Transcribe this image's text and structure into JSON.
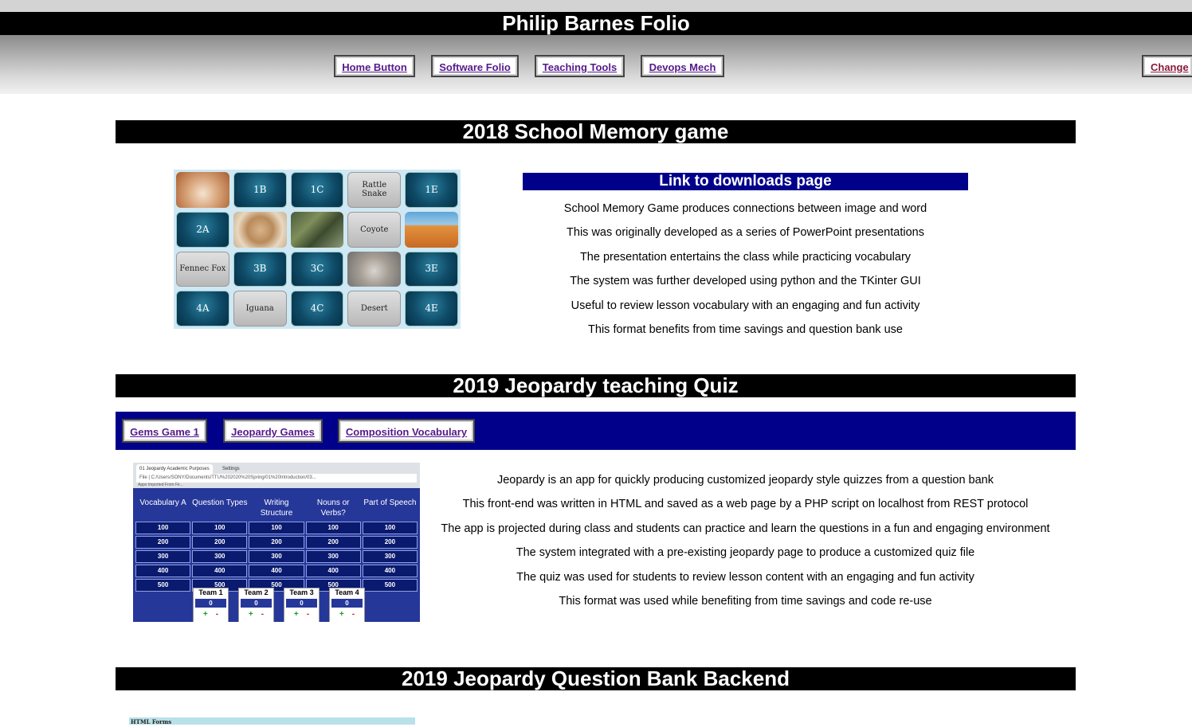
{
  "site": {
    "title": "Philip Barnes Folio"
  },
  "nav": {
    "items": [
      "Home Button",
      "Software Folio",
      "Teaching Tools",
      "Devops Mech"
    ],
    "change": "Change"
  },
  "memory_section": {
    "heading": "2018 School Memory game",
    "link": "Link to downloads page",
    "tiles": [
      "",
      "1B",
      "1C",
      "Rattle Snake",
      "1E",
      "2A",
      "",
      "",
      "Coyote",
      "",
      "Fennec Fox",
      "3B",
      "3C",
      "",
      "3E",
      "4A",
      "Iguana",
      "4C",
      "Desert",
      "4E"
    ],
    "lines": [
      "School Memory Game produces connections between image and word",
      "This was originally developed as a series of PowerPoint presentations",
      "The presentation entertains the class while practicing vocabulary",
      "The system was further developed using python and the TKinter GUI",
      "Useful to review lesson vocabulary with an engaging and fun activity",
      "This format benefits from time savings and question bank use"
    ]
  },
  "jeopardy_section": {
    "heading": "2019 Jeopardy teaching Quiz",
    "tabs": [
      "Gems Game 1",
      "Jeopardy Games",
      "Composition Vocabulary"
    ],
    "screenshot": {
      "tab1": "01 Jeopardy Academic Purposes",
      "tab2": "Settings",
      "address": "File | C:/Users/SONY/Documents/TTU%202020%20Spring/01%20Introduction/03...",
      "bookmarks": "Apps  Imported From Fir...",
      "categories": [
        "Vocabulary A",
        "Question Types",
        "Writing Structure",
        "Nouns or Verbs?",
        "Part of Speech"
      ],
      "values": [
        "100",
        "200",
        "300",
        "400",
        "500"
      ],
      "teams": [
        "Team 1",
        "Team 2",
        "Team 3",
        "Team 4"
      ],
      "score": "0",
      "plus": "+",
      "minus": "-"
    },
    "lines": [
      "Jeopardy is an app for quickly producing customized jeopardy style quizzes from a question bank",
      "This front-end was written in HTML and saved as a web page by a PHP script on localhost from REST protocol",
      "The app is projected during class and students can practice and learn the questions in a fun and engaging environment",
      "The system integrated with a pre-existing jeopardy page to produce a customized quiz file",
      "The quiz was used for students to review lesson content with an engaging and fun activity",
      "This format was used while benefiting from time savings and code re-use"
    ]
  },
  "backend_section": {
    "heading": "2019 Jeopardy Question Bank Backend",
    "image_text": "HTML Forms"
  }
}
